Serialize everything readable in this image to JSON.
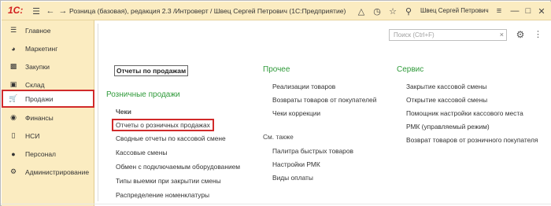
{
  "titlebar": {
    "logo": "1С:",
    "title": "Розница (базовая), редакция 2.3 /Интроверт / Швец Сергей Петрович",
    "platform": "(1С:Предприятие)",
    "user": "Швец Сергей Петрович"
  },
  "sidebar": {
    "items": [
      {
        "label": "Главное"
      },
      {
        "label": "Маркетинг"
      },
      {
        "label": "Закупки"
      },
      {
        "label": "Склад"
      },
      {
        "label": "Продажи"
      },
      {
        "label": "Финансы"
      },
      {
        "label": "НСИ"
      },
      {
        "label": "Персонал"
      },
      {
        "label": "Администрирование"
      }
    ]
  },
  "main": {
    "search_placeholder": "Поиск (Ctrl+F)",
    "col1": {
      "top_link": "Отчеты по продажам",
      "group": "Розничные продажи",
      "subhead": "Чеки",
      "links": [
        "Отчеты о розничных продажах",
        "Сводные отчеты по кассовой смене",
        "Кассовые смены",
        "Обмен с подключаемым оборудованием",
        "Типы выемки при закрытии смены",
        "Распределение номенклатуры"
      ]
    },
    "col2": {
      "group": "Прочее",
      "links": [
        "Реализации товаров",
        "Возвраты товаров от покупателей",
        "Чеки коррекции"
      ],
      "see_also": "См. также",
      "see_also_links": [
        "Палитра быстрых товаров",
        "Настройки РМК",
        "Виды оплаты"
      ]
    },
    "col3": {
      "group": "Сервис",
      "links": [
        "Закрытие кассовой смены",
        "Открытие кассовой смены",
        "Помощник настройки кассового места",
        "РМК (управляемый режим)",
        "Возврат товаров от розничного покупателя"
      ]
    }
  }
}
